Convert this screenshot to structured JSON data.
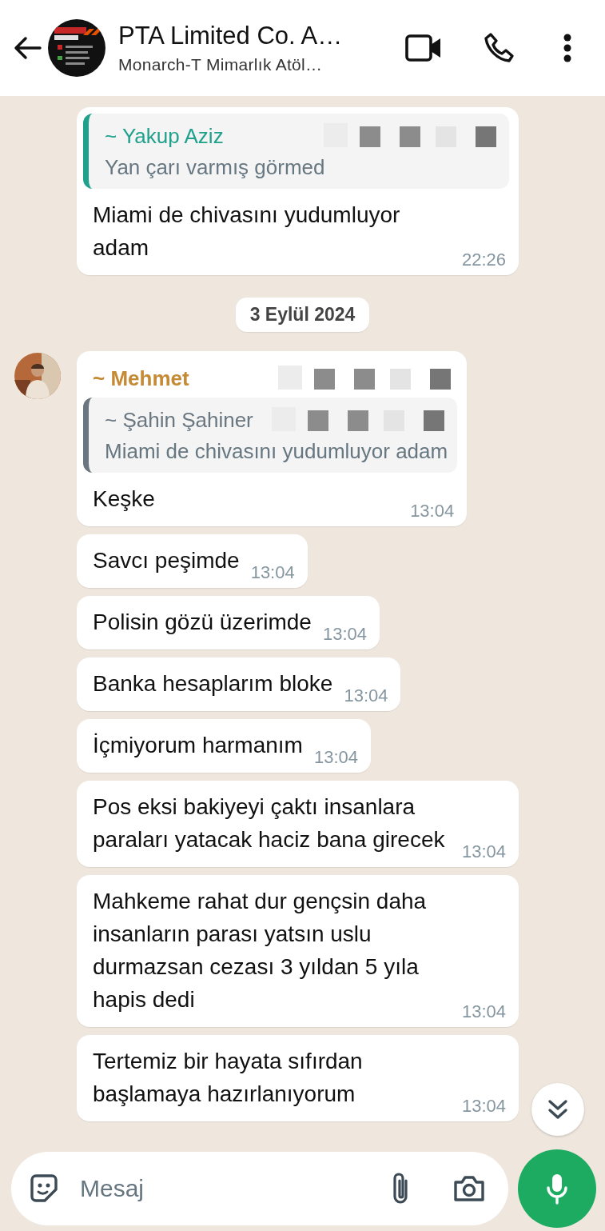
{
  "header": {
    "title": "PTA Limited Co. A…",
    "subtitle": "Monarch-T Mimarlık Atöl…"
  },
  "items": [
    {
      "kind": "message",
      "quote": {
        "author": "~ Yakup Aziz",
        "text": "Yan çarı varmış görmed",
        "color": "#1fa18c",
        "number_hidden": true
      },
      "text": "Miami de chivasını yudumluyor adam",
      "time": "22:26"
    },
    {
      "kind": "date",
      "text": "3 Eylül 2024"
    },
    {
      "kind": "message",
      "avatar": true,
      "sender": {
        "name": "~ Mehmet",
        "color": "#c58a35",
        "number_hidden": true
      },
      "quote": {
        "author": "~ Şahin Şahiner",
        "text": "Miami de chivasını yudumluyor adam",
        "color": "#6b7780",
        "number_hidden": true
      },
      "text": "Keşke",
      "time": "13:04"
    },
    {
      "kind": "message",
      "text": "Savcı peşimde",
      "time": "13:04"
    },
    {
      "kind": "message",
      "text": "Polisin gözü üzerimde",
      "time": "13:04"
    },
    {
      "kind": "message",
      "text": "Banka hesaplarım bloke",
      "time": "13:04"
    },
    {
      "kind": "message",
      "text": "İçmiyorum harmanım",
      "time": "13:04"
    },
    {
      "kind": "message",
      "text": "Pos eksi bakiyeyi çaktı insanlara paraları yatacak haciz bana girecek",
      "time": "13:04"
    },
    {
      "kind": "message",
      "text": "Mahkeme rahat dur gençsin daha insanların parası yatsın uslu durmazsan cezası 3 yıldan 5 yıla hapis dedi",
      "time": "13:04"
    },
    {
      "kind": "message",
      "text": "Tertemiz bir hayata sıfırdan başlamaya hazırlanıyorum",
      "time": "13:04"
    }
  ],
  "composer": {
    "placeholder": "Mesaj"
  }
}
